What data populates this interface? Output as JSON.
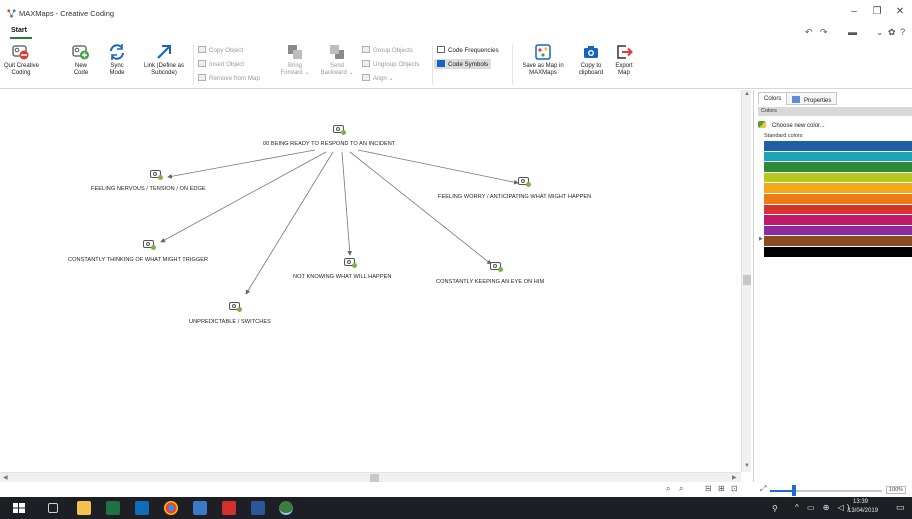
{
  "window": {
    "title": "MAXMaps - Creative Coding",
    "controls": {
      "minimize": "–",
      "maximize": "❐",
      "close": "✕"
    }
  },
  "ribbon_tabs": [
    {
      "label": "Start",
      "active": true
    }
  ],
  "quick_access": {
    "undo": "↶",
    "redo": "↷",
    "print": "▬",
    "options": "⌄ ✿ ?"
  },
  "ribbon": {
    "quit": "Quit Creative\nCoding",
    "new_code": "New\nCode",
    "sync_mode": "Sync\nMode",
    "link": "Link (Define as\nSubcode)",
    "copy_object": "Copy Object",
    "insert_object": "Insert Object",
    "remove_from_map": "Remove from Map",
    "bring_forward": "Bring\nForward ⌄",
    "send_backward": "Send\nBackward ⌄",
    "group_objects": "Group Objects",
    "ungroup_objects": "Ungroup Objects",
    "align": "Align ⌄",
    "code_frequencies": "Code Frequencies",
    "code_symbols": "Code Symbols",
    "save_as_map": "Save as Map in\nMAXMaps",
    "copy_clipboard": "Copy to\nclipboard",
    "export_map": "Export\nMap"
  },
  "map": {
    "root": "00 BEING READY TO RESPOND TO AN INCIDENT",
    "children": [
      "FEELING NERVOUS / TENSION / ON EDGE",
      "FEELING WORRY / ANTICIPATING WHAT MIGHT HAPPEN",
      "CONSTANTLY THINKING OF WHAT MIGHT TRIGGER",
      "NOT KNOWING WHAT WILL HAPPEN",
      "CONSTANTLY KEEPING AN EYE ON HIM",
      "UNPREDICTABLE / SWITCHES"
    ]
  },
  "right_panel": {
    "tabs": [
      "Colors",
      "Properties"
    ],
    "active_tab": "Colors",
    "section_header": "Colors",
    "choose_new_color": "Choose new color...",
    "standard_colors_label": "Standard colors",
    "swatches": [
      "#1f5fa6",
      "#1aa6b7",
      "#2d8a3a",
      "#b9c81e",
      "#f4a91a",
      "#ee7a16",
      "#d8322f",
      "#c0196b",
      "#8e2a9b",
      "#8a4b1e",
      "#000000"
    ]
  },
  "status": {
    "zoom_value": "100%",
    "zoom_fraction": 0.2
  },
  "taskbar": {
    "time": "13:39",
    "date": "13/04/2019"
  }
}
